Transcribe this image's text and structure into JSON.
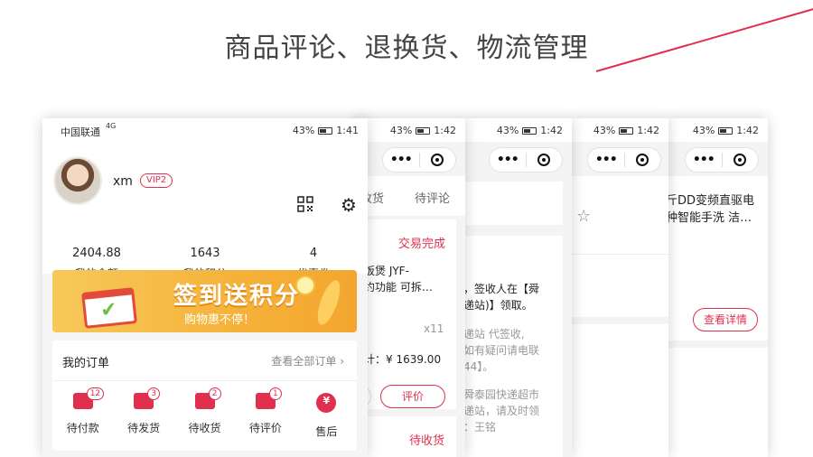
{
  "headline": "商品评论、退换货、物流管理",
  "colors": {
    "accent": "#e0304e",
    "banner": "#f5b23a"
  },
  "phone1": {
    "carrier": "中国联通",
    "network": "4G",
    "battery": "43%",
    "time": "1:41",
    "capsule_dots": "•••",
    "username": "xm",
    "vip": "VIP2",
    "icons": [
      "qr-code-icon",
      "gear-icon"
    ],
    "stats": [
      {
        "value": "2404.88",
        "label": "我的余额"
      },
      {
        "value": "1643",
        "label": "我的积分"
      },
      {
        "value": "4",
        "label": "优惠券"
      }
    ],
    "banner": {
      "title": "签到送积分",
      "subtitle": "购物惠不停！"
    },
    "orders": {
      "title": "我的订单",
      "view_all": "查看全部订单",
      "items": [
        {
          "label": "待付款",
          "badge": "12",
          "icon": "wallet-icon"
        },
        {
          "label": "待发货",
          "badge": "3",
          "icon": "box-icon"
        },
        {
          "label": "待收货",
          "badge": "2",
          "icon": "truck-icon"
        },
        {
          "label": "待评价",
          "badge": "1",
          "icon": "comment-icon"
        },
        {
          "label": "售后",
          "badge": "",
          "icon": "yen-icon"
        }
      ]
    }
  },
  "phone2": {
    "battery": "43%",
    "time": "1:42",
    "tabs": [
      "收货",
      "待评论"
    ],
    "status": "交易完成",
    "product_line1": "饭煲 JYF-",
    "product_line2": "约功能 可拆…",
    "qty": "x11",
    "total": "计：¥ 1639.00",
    "review_button": "评价",
    "status2": "待收货"
  },
  "phone3": {
    "battery": "43%",
    "time": "1:42",
    "lines": [
      {
        "text": "，签收人在【舜",
        "style": "strong"
      },
      {
        "text": "递站)】领取。",
        "style": "strong"
      },
      {
        "text": "递站 代签收,",
        "style": "muted"
      },
      {
        "text": "如有疑问请电联",
        "style": "muted"
      },
      {
        "text": "44】。",
        "style": "muted"
      },
      {
        "text": "舜泰园快递超市",
        "style": "muted"
      },
      {
        "text": "递站，请及时领",
        "style": "muted"
      },
      {
        "text": "：王铭",
        "style": "muted"
      }
    ]
  },
  "phone4": {
    "battery": "43%",
    "time": "1:42"
  },
  "phone5": {
    "battery": "43%",
    "time": "1:42",
    "product_line1": "斤DD变频直驱电",
    "product_line2": "种智能手洗 洁…",
    "detail_button": "查看详情"
  }
}
